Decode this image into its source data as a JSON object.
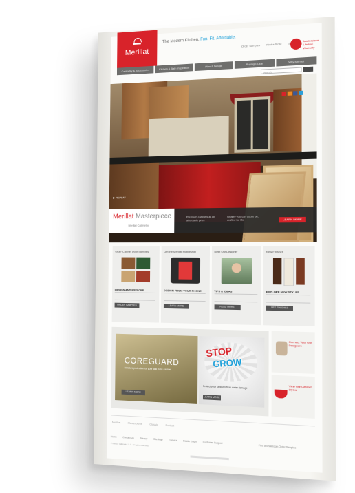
{
  "brand": {
    "name": "Merillat",
    "accent": "#d8232a",
    "link": "#1c9fd9"
  },
  "header": {
    "tagline_start": "The Modern Kitchen.",
    "tagline_highlight": "Fun. Fit. Affordable.",
    "top_links": [
      "Order Samples",
      "Find a Store",
      "Sign In"
    ],
    "seal_text": "Masterpiece Lifetime Warranty",
    "search_placeholder": "Search"
  },
  "nav": [
    "Cabinetry & Accessories",
    "Kitchen & Bath Inspiration",
    "Plan & Design",
    "Buying Guide",
    "Why Merillat"
  ],
  "hero": {
    "replay": "REPLAY",
    "social_icons": [
      "email-icon",
      "rss-icon",
      "facebook-icon",
      "twitter-icon"
    ],
    "promo_title": "Merillat",
    "promo_title_2": "Masterpiece",
    "promo_sub": "Merillat Cabinetry",
    "promo_col1": "Premium cabinets at an affordable price",
    "promo_col2": "Quality you can count on, crafted for life",
    "promo_button": "LEARN MORE"
  },
  "cards": [
    {
      "heading": "Order Cabinet Door Samples",
      "title": "DESIGN AND EXPLORE",
      "button": "ORDER SAMPLES"
    },
    {
      "heading": "Get the Merillat Mobile App",
      "title": "DESIGN FROM YOUR PHONE",
      "button": "LEARN MORE"
    },
    {
      "heading": "Meet Our Designer",
      "title": "TIPS & IDEAS",
      "button": "READ MORE"
    },
    {
      "heading": "New Finishes",
      "title": "EXPLORE NEW STYLES",
      "button": "SEE FINISHES"
    }
  ],
  "feature": {
    "coreguard_title": "COREGUARD",
    "coreguard_sub": "Moisture protection for your sink base cabinet",
    "coreguard_button": "LEARN MORE",
    "stop_word": "STOP",
    "grow_word": "GROW",
    "stop_text": "Protect your cabinets from water damage",
    "stop_button": "LEARN MORE"
  },
  "sidebar": [
    {
      "text": "Connect With Our Designers"
    },
    {
      "text": "View Our Cabinet Styles"
    }
  ],
  "footer": {
    "logos": [
      "Merillat",
      "Masterpiece",
      "Classic",
      "Portrait"
    ],
    "links": [
      "Home",
      "Contact Us",
      "Privacy",
      "Site Map",
      "Careers",
      "Dealer Login",
      "Customer Support"
    ],
    "copyright": "© Masco Cabinetry LLC. All rights reserved.",
    "right": "Find a Showroom   Order Samples"
  }
}
